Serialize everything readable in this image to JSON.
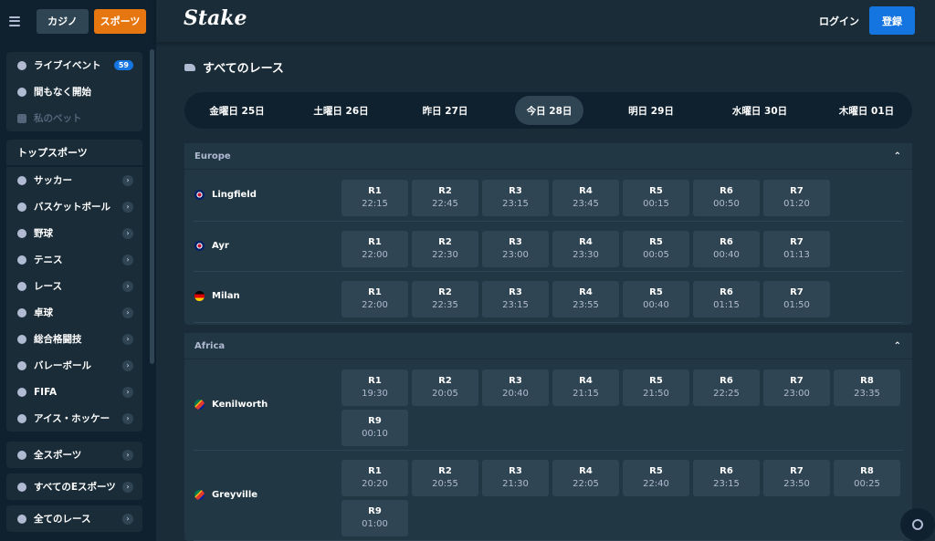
{
  "header": {
    "casino_label": "カジノ",
    "sports_label": "スポーツ",
    "logo": "Stake",
    "login_label": "ログイン",
    "register_label": "登録"
  },
  "sidebar": {
    "block1": [
      {
        "label": "ライブイベント",
        "icon": "live-icon",
        "badge": "59"
      },
      {
        "label": "間もなく開始",
        "icon": "timer-icon"
      },
      {
        "label": "私のベット",
        "icon": "ticket-icon",
        "dim": true
      }
    ],
    "top_sports_title": "トップスポーツ",
    "top_sports": [
      {
        "label": "サッカー",
        "icon": "soccer-icon"
      },
      {
        "label": "バスケットボール",
        "icon": "basketball-icon"
      },
      {
        "label": "野球",
        "icon": "baseball-icon"
      },
      {
        "label": "テニス",
        "icon": "tennis-icon"
      },
      {
        "label": "レース",
        "icon": "horse-racing-icon"
      },
      {
        "label": "卓球",
        "icon": "table-tennis-icon"
      },
      {
        "label": "総合格闘技",
        "icon": "mma-icon"
      },
      {
        "label": "バレーボール",
        "icon": "volleyball-icon"
      },
      {
        "label": "FIFA",
        "icon": "fifa-icon"
      },
      {
        "label": "アイス・ホッケー",
        "icon": "ice-hockey-icon"
      }
    ],
    "all_sports": "全スポーツ",
    "all_esports": "すべてのEスポーツ",
    "all_races": "全てのレース"
  },
  "main": {
    "title": "すべてのレース",
    "days": [
      "金曜日 25日",
      "土曜日 26日",
      "昨日 27日",
      "今日 28日",
      "明日 29日",
      "水曜日 30日",
      "木曜日 01日"
    ],
    "active_day": 3,
    "regions": [
      {
        "name": "Europe",
        "tracks": [
          {
            "name": "Lingfield",
            "flag": "gb",
            "races": [
              [
                "R1",
                "22:15"
              ],
              [
                "R2",
                "22:45"
              ],
              [
                "R3",
                "23:15"
              ],
              [
                "R4",
                "23:45"
              ],
              [
                "R5",
                "00:15"
              ],
              [
                "R6",
                "00:50"
              ],
              [
                "R7",
                "01:20"
              ]
            ]
          },
          {
            "name": "Ayr",
            "flag": "gb",
            "races": [
              [
                "R1",
                "22:00"
              ],
              [
                "R2",
                "22:30"
              ],
              [
                "R3",
                "23:00"
              ],
              [
                "R4",
                "23:30"
              ],
              [
                "R5",
                "00:05"
              ],
              [
                "R6",
                "00:40"
              ],
              [
                "R7",
                "01:13"
              ]
            ]
          },
          {
            "name": "Milan",
            "flag": "de",
            "races": [
              [
                "R1",
                "22:00"
              ],
              [
                "R2",
                "22:35"
              ],
              [
                "R3",
                "23:15"
              ],
              [
                "R4",
                "23:55"
              ],
              [
                "R5",
                "00:40"
              ],
              [
                "R6",
                "01:15"
              ],
              [
                "R7",
                "01:50"
              ]
            ]
          }
        ]
      },
      {
        "name": "Africa",
        "tracks": [
          {
            "name": "Kenilworth",
            "flag": "za",
            "races": [
              [
                "R1",
                "19:30"
              ],
              [
                "R2",
                "20:05"
              ],
              [
                "R3",
                "20:40"
              ],
              [
                "R4",
                "21:15"
              ],
              [
                "R5",
                "21:50"
              ],
              [
                "R6",
                "22:25"
              ],
              [
                "R7",
                "23:00"
              ],
              [
                "R8",
                "23:35"
              ],
              [
                "R9",
                "00:10"
              ]
            ]
          },
          {
            "name": "Greyville",
            "flag": "za",
            "races": [
              [
                "R1",
                "20:20"
              ],
              [
                "R2",
                "20:55"
              ],
              [
                "R3",
                "21:30"
              ],
              [
                "R4",
                "22:05"
              ],
              [
                "R5",
                "22:40"
              ],
              [
                "R6",
                "23:15"
              ],
              [
                "R7",
                "23:50"
              ],
              [
                "R8",
                "00:25"
              ],
              [
                "R9",
                "01:00"
              ]
            ]
          }
        ]
      }
    ]
  }
}
